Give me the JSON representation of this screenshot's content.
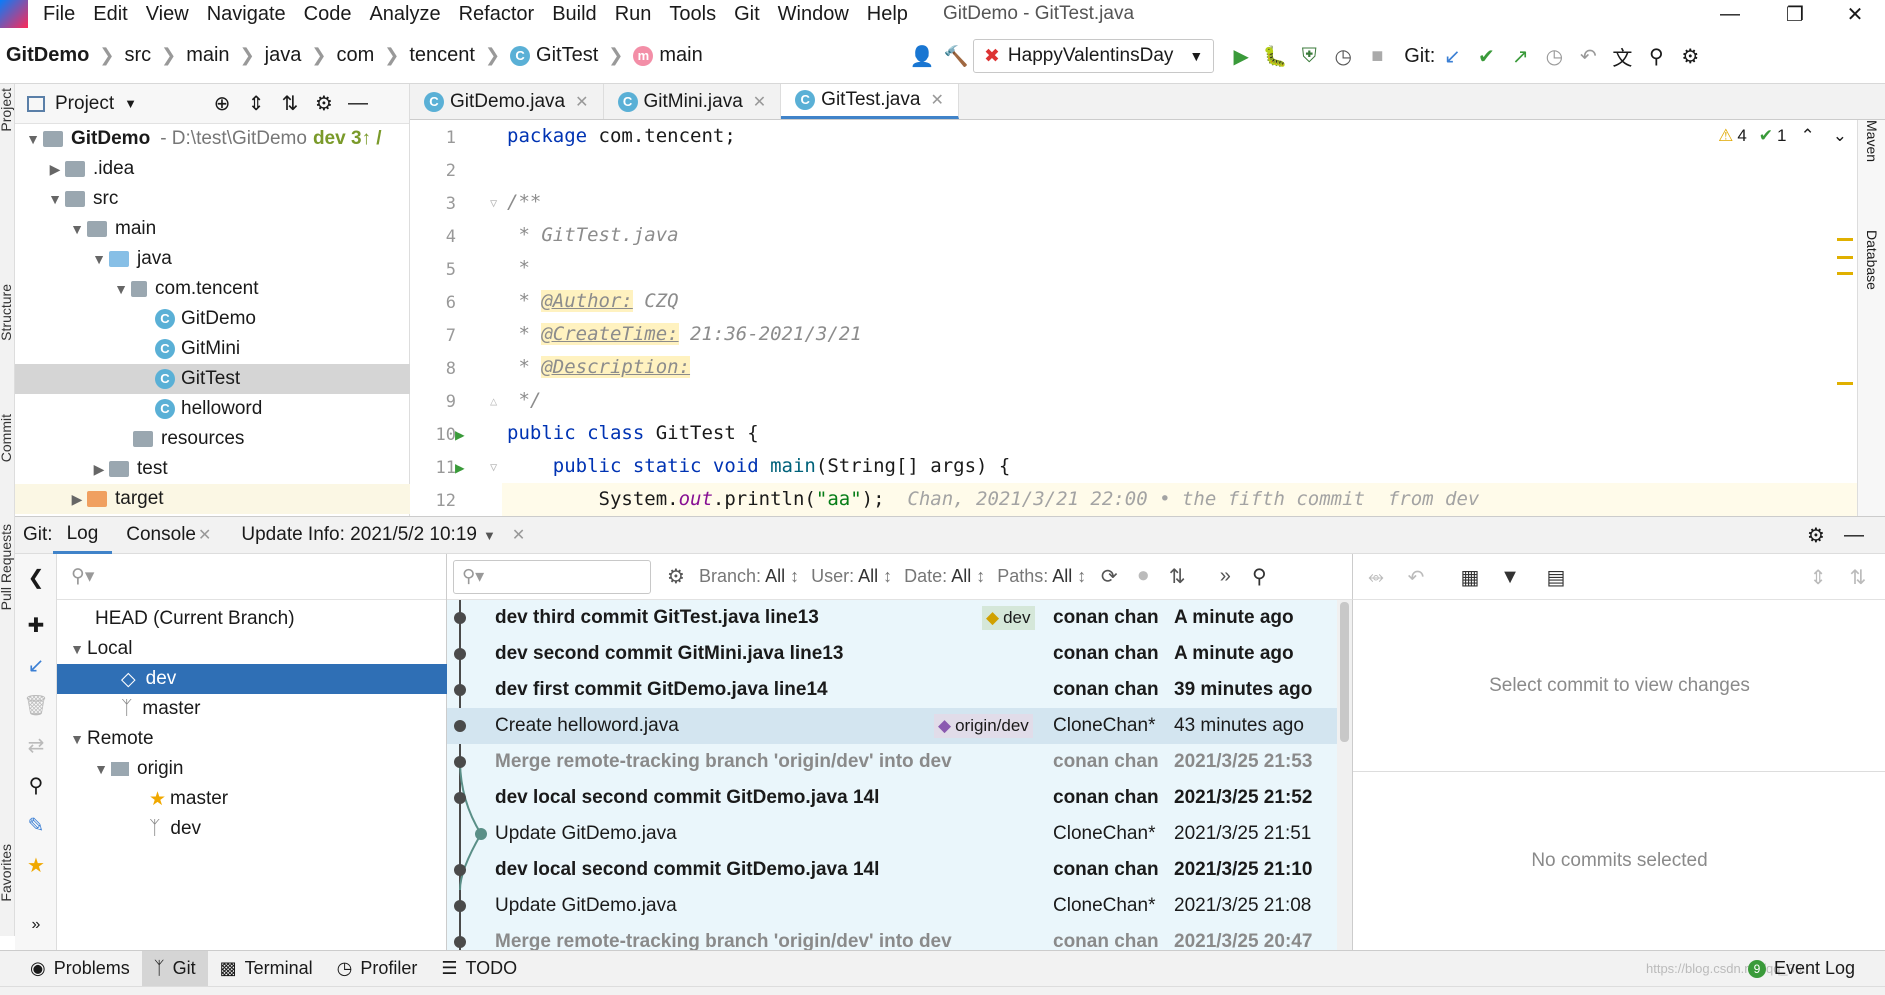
{
  "menu": {
    "items": [
      "File",
      "Edit",
      "View",
      "Navigate",
      "Code",
      "Analyze",
      "Refactor",
      "Build",
      "Run",
      "Tools",
      "Git",
      "Window",
      "Help"
    ],
    "window_title": "GitDemo - GitTest.java"
  },
  "breadcrumb": {
    "items": [
      "GitDemo",
      "src",
      "main",
      "java",
      "com",
      "tencent",
      "GitTest",
      "main"
    ]
  },
  "toolbar": {
    "run_config": "HappyValentinsDay",
    "git_label": "Git:"
  },
  "left_strip": {
    "labels": [
      "Project",
      "Structure",
      "Commit",
      "Pull Requests",
      "Favorites"
    ]
  },
  "project": {
    "header": "Project",
    "tree": [
      {
        "label": "GitDemo",
        "extra": "- D:\\test\\GitDemo",
        "branch": "dev 3↑ /"
      },
      {
        "label": ".idea"
      },
      {
        "label": "src"
      },
      {
        "label": "main"
      },
      {
        "label": "java"
      },
      {
        "label": "com.tencent"
      },
      {
        "label": "GitDemo"
      },
      {
        "label": "GitMini"
      },
      {
        "label": "GitTest"
      },
      {
        "label": "helloword"
      },
      {
        "label": "resources"
      },
      {
        "label": "test"
      },
      {
        "label": "target"
      }
    ]
  },
  "editor": {
    "tabs": [
      "GitDemo.java",
      "GitMini.java",
      "GitTest.java"
    ],
    "inspections": {
      "warnings": "4",
      "ok": "1"
    },
    "lines": [
      "1",
      "2",
      "3",
      "4",
      "5",
      "6",
      "7",
      "8",
      "9",
      "10",
      "11",
      "12"
    ],
    "code": {
      "l1_kw": "package",
      "l1_rest": " com.tencent;",
      "l3": "/**",
      "l4": " * GitTest.java",
      "l5": " *",
      "l6_pre": " * ",
      "l6_tag": "@Author:",
      "l6_val": " CZQ",
      "l7_pre": " * ",
      "l7_tag": "@CreateTime:",
      "l7_val": " 21:36-2021/3/21",
      "l8_pre": " * ",
      "l8_tag": "@Description:",
      "l9": " */",
      "l10_kw": "public class",
      "l10_rest": " GitTest {",
      "l11_kw": "    public static void",
      "l11_meth": " main",
      "l11_rest": "(String[] args) {",
      "l12_a": "        System.",
      "l12_fld": "out",
      "l12_b": ".println(",
      "l12_str": "\"aa\"",
      "l12_c": ");",
      "l12_blame": "  Chan, 2021/3/21 22:00 • the fifth commit  from dev"
    }
  },
  "git": {
    "label": "Git:",
    "tabs": [
      "Log",
      "Console",
      "Update Info: 2021/5/2 10:19"
    ],
    "branches": {
      "head": "HEAD (Current Branch)",
      "local": "Local",
      "local_items": [
        "dev",
        "master"
      ],
      "remote": "Remote",
      "origin": "origin",
      "origin_items": [
        "master",
        "dev"
      ]
    },
    "filters": {
      "branch": "Branch:",
      "branch_val": "All",
      "user": "User:",
      "user_val": "All",
      "date": "Date:",
      "date_val": "All",
      "paths": "Paths:",
      "paths_val": "All"
    },
    "commits": [
      {
        "subject": "dev third commit GitTest.java line13",
        "ref": "dev",
        "author": "conan chan",
        "date": "A minute ago"
      },
      {
        "subject": "dev second commit GitMini.java line13",
        "author": "conan chan",
        "date": "A minute ago"
      },
      {
        "subject": "dev first   commit GitDemo.java line14",
        "author": "conan chan",
        "date": "39 minutes ago"
      },
      {
        "subject": "Create helloword.java",
        "ref": "origin/dev",
        "author": "CloneChan*",
        "date": "43 minutes ago"
      },
      {
        "subject": "Merge remote-tracking branch 'origin/dev' into dev",
        "author": "conan chan",
        "date": "2021/3/25 21:53"
      },
      {
        "subject": "dev local second  commit GitDemo.java 14l",
        "author": "conan chan",
        "date": "2021/3/25 21:52"
      },
      {
        "subject": "Update GitDemo.java",
        "author": "CloneChan*",
        "date": "2021/3/25 21:51"
      },
      {
        "subject": "dev local second  commit GitDemo.java 14l",
        "author": "conan chan",
        "date": "2021/3/25 21:10"
      },
      {
        "subject": "Update GitDemo.java",
        "author": "CloneChan*",
        "date": "2021/3/25 21:08"
      },
      {
        "subject": "Merge remote-tracking branch 'origin/dev' into dev",
        "author": "conan chan",
        "date": "2021/3/25 20:47"
      }
    ],
    "detail_top": "Select commit to view changes",
    "detail_bottom": "No commits selected"
  },
  "bottom": {
    "tabs": [
      "Problems",
      "Git",
      "Terminal",
      "Profiler",
      "TODO"
    ],
    "event_log": "Event Log",
    "event_count": "9",
    "watermark": "https://blog.csdn.net/qq_39..."
  },
  "colors": {
    "accent": "#4083c9",
    "selection": "#2f6fb5",
    "log_bg": "#eaf6fb"
  }
}
